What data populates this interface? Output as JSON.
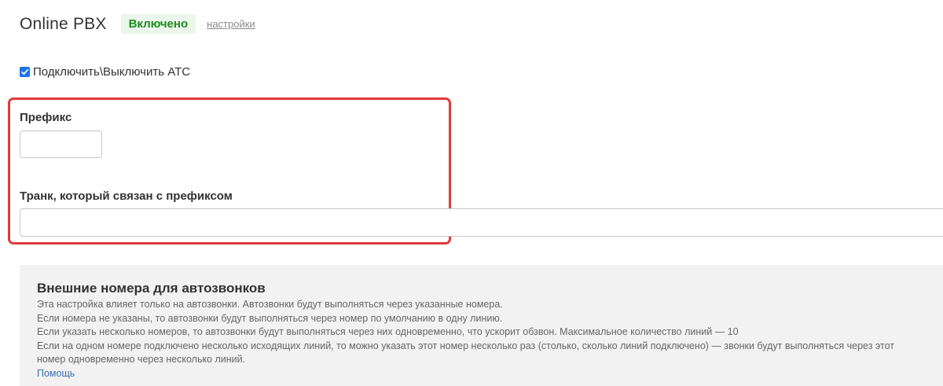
{
  "header": {
    "title": "Online PBX",
    "status": "Включено",
    "settings_link": "настройки"
  },
  "toggle": {
    "label": "Подключить\\Выключить АТС",
    "checked": true
  },
  "prefix": {
    "label": "Префикс",
    "value": ""
  },
  "trunk": {
    "label": "Транк, который связан с префиксом",
    "value": ""
  },
  "info": {
    "title": "Внешние номера для автозвонков",
    "lines": [
      "Эта настройка влияет только на автозвонки. Автозвонки будут выполняться через указанные номера.",
      "Если номера не указаны, то автозвонки будут выполняться через номер по умолчанию в одну линию.",
      "Если указать несколько номеров, то автозвонки будут выполняться через них одновременно, что ускорит обзвон. Максимальное количество линий — 10",
      "Если на одном номере подключено несколько исходящих линий, то можно указать этот номер несколько раз (столько, сколько линий подключено) — звонки будут выполняться через этот",
      "номер одновременно через несколько линий."
    ],
    "help_link": "Помощь"
  },
  "colors": {
    "highlight": "#e03a3a",
    "status_green": "#1f8a1f",
    "checkbox_blue": "#1a73e8",
    "link_blue": "#3a6fb0"
  }
}
